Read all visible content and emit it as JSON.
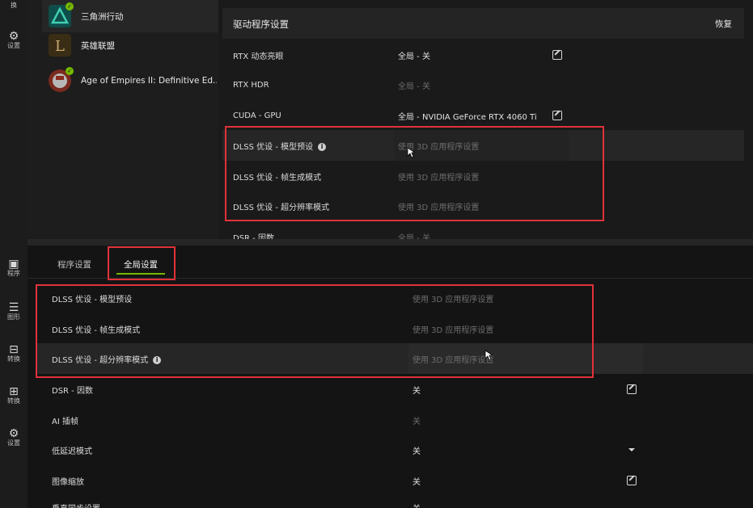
{
  "rail": {
    "items": [
      {
        "label": "换",
        "icon": "swap-icon"
      },
      {
        "label": "设置",
        "icon": "gear-icon"
      },
      {
        "label": "程序",
        "icon": "program-icon"
      },
      {
        "label": "图形",
        "icon": "graphics-icon"
      },
      {
        "label": "转换",
        "icon": "convert-icon"
      },
      {
        "label": "转换",
        "icon": "gift-icon"
      },
      {
        "label": "设置",
        "icon": "gear-icon"
      }
    ]
  },
  "games": [
    {
      "name": "三角洲行动",
      "icon_color": "#0f4d4a",
      "badge": true
    },
    {
      "name": "英雄联盟",
      "icon_color": "#3a2d15",
      "badge": false
    },
    {
      "name": "Age of Empires II: Definitive Ed...",
      "icon_color": "#7a2a1f",
      "badge": true
    }
  ],
  "driver": {
    "title": "驱动程序设置",
    "restore": "恢复",
    "rows": [
      {
        "key": "RTX 动态亮眼",
        "value": "全局 - 关",
        "active": true,
        "edit": true
      },
      {
        "key": "RTX HDR",
        "value": "全局 - 关",
        "active": false,
        "edit": false
      },
      {
        "key": "CUDA - GPU",
        "value": "全局 - NVIDIA GeForce RTX 4060 Ti",
        "active": true,
        "edit": true
      },
      {
        "key": "DLSS 优设 - 模型预设",
        "value": "使用 3D 应用程序设置",
        "active": false,
        "edit": false,
        "info": true
      },
      {
        "key": "DLSS 优设 - 帧生成模式",
        "value": "使用 3D 应用程序设置",
        "active": false,
        "edit": false
      },
      {
        "key": "DLSS 优设 - 超分辨率模式",
        "value": "使用 3D 应用程序设置",
        "active": false,
        "edit": false
      },
      {
        "key": "DSR - 因数",
        "value": "全局 - 关",
        "active": false,
        "edit": false
      }
    ]
  },
  "tabs": [
    {
      "label": "程序设置"
    },
    {
      "label": "全局设置"
    }
  ],
  "global": {
    "rows": [
      {
        "key": "DLSS 优设 - 模型预设",
        "value": "使用 3D 应用程序设置",
        "active": false
      },
      {
        "key": "DLSS 优设 - 帧生成模式",
        "value": "使用 3D 应用程序设置",
        "active": false
      },
      {
        "key": "DLSS 优设 - 超分辨率模式",
        "value": "使用 3D 应用程序设置",
        "active": false,
        "info": true
      },
      {
        "key": "DSR - 因数",
        "value": "关",
        "active": true,
        "control": "edit"
      },
      {
        "key": "AI 插帧",
        "value": "关",
        "active": false,
        "control": "none"
      },
      {
        "key": "低延迟模式",
        "value": "关",
        "active": true,
        "control": "dropdown"
      },
      {
        "key": "图像缩放",
        "value": "关",
        "active": true,
        "control": "edit"
      },
      {
        "key": "垂直同步设置",
        "value": "关",
        "active": true,
        "control": "edit"
      }
    ]
  },
  "colors": {
    "accent": "#76b900",
    "highlight_box": "#e0323a"
  }
}
